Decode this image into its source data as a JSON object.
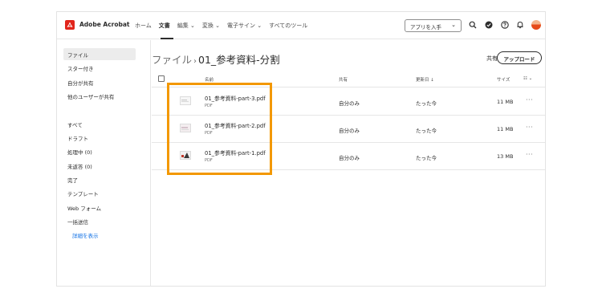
{
  "app": {
    "name": "Adobe Acrobat"
  },
  "nav": {
    "home": "ホーム",
    "documents": "文書",
    "edit": "編集 ⌄",
    "convert": "変換 ⌄",
    "esign": "電子サイン ⌄",
    "all_tools": "すべてのツール"
  },
  "header": {
    "get_app": "アプリを入手",
    "get_app_chevron": "⌄"
  },
  "sidebar": {
    "items": [
      {
        "label": "ファイル"
      },
      {
        "label": "スター付き"
      },
      {
        "label": "自分が共有"
      },
      {
        "label": "他のユーザーが共有"
      },
      {
        "label": "すべて"
      },
      {
        "label": "ドラフト"
      },
      {
        "label": "処理中 (0)"
      },
      {
        "label": "未返答 (0)"
      },
      {
        "label": "完了"
      },
      {
        "label": "テンプレート"
      },
      {
        "label": "Web フォーム"
      },
      {
        "label": "一括送信"
      },
      {
        "label": "詳細を表示"
      }
    ]
  },
  "main": {
    "breadcrumb_parent": "ファイル",
    "breadcrumb_sep": "›",
    "breadcrumb_current": "01_参考資料-分割",
    "share_label": "共有",
    "upload_label": "アップロード",
    "columns": {
      "name": "名前",
      "shared": "共有",
      "updated": "更新日 ↓",
      "size": "サイズ",
      "view": "☷ ⌄"
    },
    "rows": [
      {
        "name": "01_参考資料-part-3.pdf",
        "type": "PDF",
        "shared": "自分のみ",
        "updated": "たった今",
        "size": "11 MB",
        "more": "···"
      },
      {
        "name": "01_参考資料-part-2.pdf",
        "type": "PDF",
        "shared": "自分のみ",
        "updated": "たった今",
        "size": "11 MB",
        "more": "···"
      },
      {
        "name": "01_参考資料-part-1.pdf",
        "type": "PDF",
        "shared": "自分のみ",
        "updated": "たった今",
        "size": "13 MB",
        "more": "···"
      }
    ]
  },
  "colors": {
    "accent": "#e1251b",
    "highlight": "#f39800",
    "link": "#1473e6",
    "selected_bg": "#ececec"
  },
  "icons": [
    "acrobat-logo-icon",
    "search-icon",
    "check-circle-icon",
    "help-icon",
    "bell-icon",
    "share-icon",
    "chevron-down-icon",
    "more-icon",
    "pdf-thumbnail-icon"
  ]
}
